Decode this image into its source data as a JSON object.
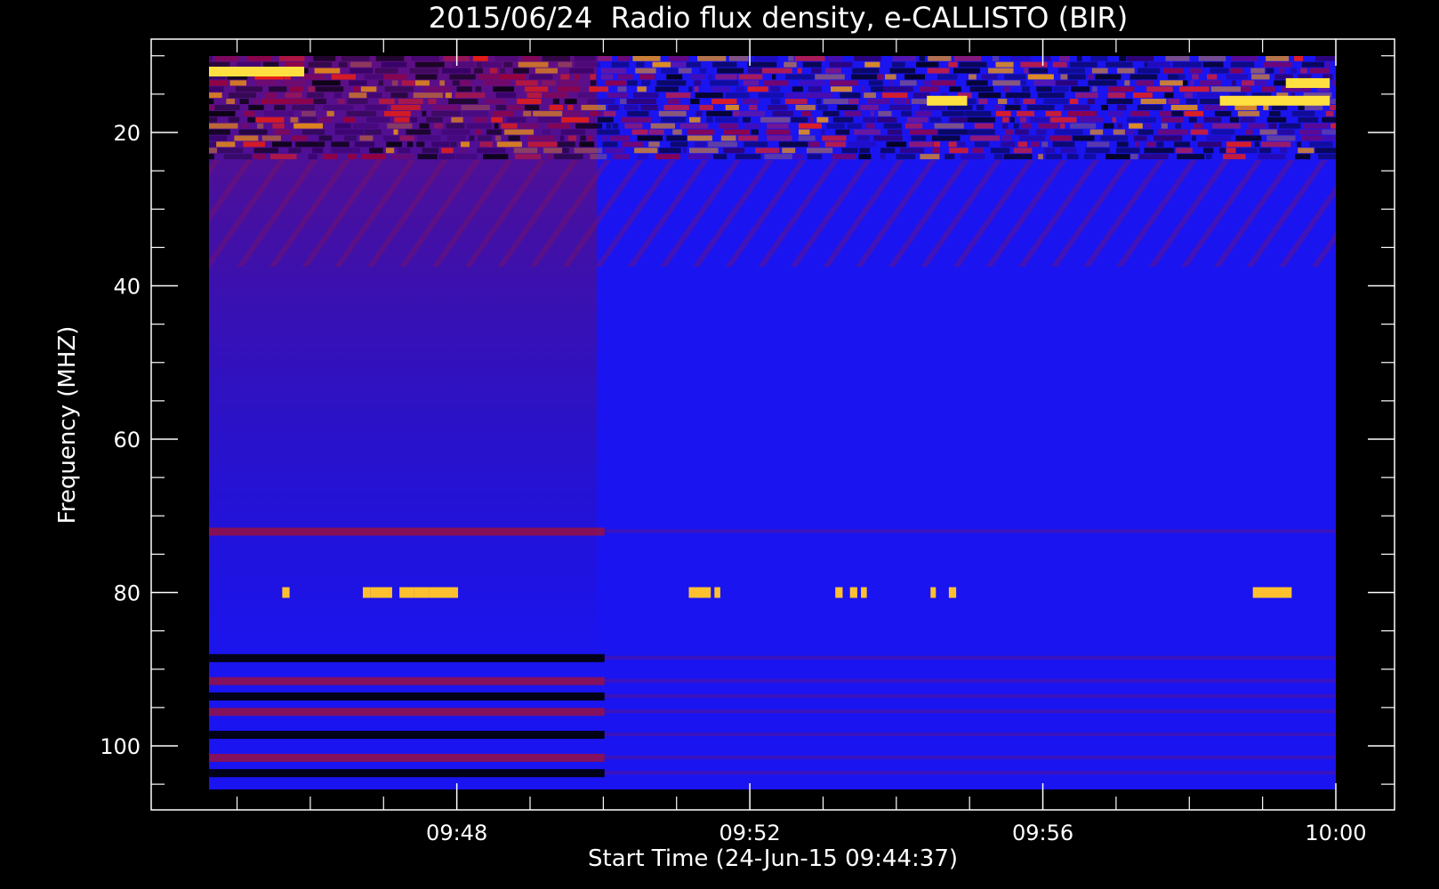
{
  "chart_data": {
    "type": "heatmap",
    "title": "2015/06/24  Radio flux density, e-CALLISTO (BIR)",
    "xlabel": "Start Time (24-Jun-15 09:44:37)",
    "ylabel": "Frequency (MHZ)",
    "x_range": [
      "09:44:37",
      "10:00:00"
    ],
    "y_range_mhz": [
      10,
      106
    ],
    "y_inverted": true,
    "x_ticks": [
      "09:48",
      "09:52",
      "09:56",
      "10:00"
    ],
    "x_tick_minutes": [
      3.383,
      7.383,
      11.383,
      15.383
    ],
    "x_minor_tick_minutes": [
      0.383,
      1.383,
      2.383,
      4.383,
      5.383,
      6.383,
      8.383,
      9.383,
      10.383,
      12.383,
      13.383,
      14.383
    ],
    "y_ticks": [
      20,
      40,
      60,
      80,
      100
    ],
    "y_minor_ticks": [
      10,
      15,
      25,
      30,
      35,
      45,
      50,
      55,
      65,
      70,
      75,
      85,
      90,
      95,
      105
    ],
    "colormap": [
      "#000000",
      "#0000ff",
      "#a00030",
      "#ff2000",
      "#ffa000",
      "#ffff60"
    ],
    "background_level": "blue",
    "features": {
      "interference_band_mhz": [
        10,
        23
      ],
      "calibration_switch_minute": 5.4,
      "horizontal_lines_mhz": [
        72,
        88.5,
        91.5,
        93.5,
        95.5,
        98.5,
        101.5,
        103.5
      ],
      "bursts_at_80_mhz_minutes": [
        [
          1.0,
          1.1
        ],
        [
          2.1,
          2.2
        ],
        [
          2.2,
          2.5
        ],
        [
          2.6,
          2.8
        ],
        [
          2.8,
          3.0
        ],
        [
          3.0,
          3.4
        ],
        [
          6.55,
          6.85
        ],
        [
          6.9,
          6.98
        ],
        [
          8.55,
          8.65
        ],
        [
          8.75,
          8.85
        ],
        [
          8.9,
          8.98
        ],
        [
          9.85,
          9.92
        ],
        [
          10.1,
          10.2
        ],
        [
          14.25,
          14.78
        ]
      ],
      "bright_strips_upper": [
        {
          "minute_start": 0.0,
          "minute_end": 1.3,
          "mhz": 12.0
        },
        {
          "minute_start": 9.8,
          "minute_end": 10.35,
          "mhz": 15.8
        },
        {
          "minute_start": 13.8,
          "minute_end": 15.3,
          "mhz": 15.8
        },
        {
          "minute_start": 14.7,
          "minute_end": 15.3,
          "mhz": 13.5
        }
      ]
    }
  }
}
